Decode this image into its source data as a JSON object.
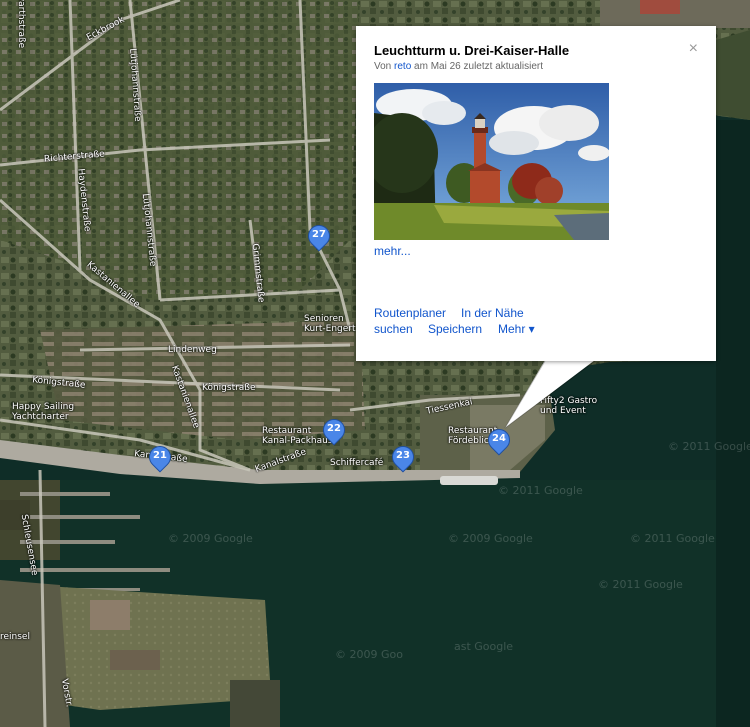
{
  "info_window": {
    "title": "Leuchtturm u. Drei-Kaiser-Halle",
    "sub_prefix": "Von",
    "author": "reto",
    "sub_suffix": "am Mai 26 zuletzt aktualisiert",
    "close_icon": "×",
    "more_link": "mehr...",
    "actions": {
      "route": "Routenplaner",
      "nearby_1": "In der Nähe",
      "nearby_2": "suchen",
      "save": "Speichern",
      "more": "Mehr ▾"
    }
  },
  "markers": [
    "27",
    "21",
    "22",
    "23",
    "24"
  ],
  "streets": {
    "eckbrook": "Eckbrook",
    "warthstrasse": "warthstraße",
    "richterstrasse": "Richterstraße",
    "luetjohannstrasse": "Lütjohannstraße",
    "luetjohannstrasse2": "Lütjohannstraße",
    "haydenstrasse": "Haydenstraße",
    "grimmstrasse": "Grimmstraße",
    "kastanienallee": "Kastanienallee",
    "kastanienallee2": "Kastanienallee",
    "lindenweg": "Lindenweg",
    "koenigstrasse": "Königstraße",
    "koenigstrasse2": "Königstraße",
    "kanalstrasse": "Kanalstraße",
    "kanalstrasse2": "Kanalstraße",
    "tiessenkai": "Tiessenkai",
    "seeweg": "Schleusensee",
    "reinsel": "reinsel",
    "vorstrasse": "Vorstr."
  },
  "pois": {
    "senioren": "Senioren\nKurt-Engert",
    "happy_sailing": "Happy Sailing\nYachtcharter",
    "restaurant_packhaus": "Restaurant\nKanal-Packhaus",
    "schiffercafe": "Schiffercafé",
    "restaurant_foerdeblick": "Restaurant\nFördeblick",
    "fifty2": "Fifty2 Gastro\nund Event"
  },
  "watermarks": [
    "© 2011 Google",
    "© 2011 Google",
    "© 2009 Google",
    "© 2009 Google",
    "© 2011 Google",
    "© 2009 Goo",
    "© 2011 Google",
    "ast Google"
  ],
  "colors": {
    "marker_blue": "#4a86e8",
    "link_blue": "#1155cc",
    "water": "#0d2a24",
    "land": "#4b5238"
  },
  "icons": {
    "close": "close-icon",
    "marker": "map-pin-icon"
  }
}
